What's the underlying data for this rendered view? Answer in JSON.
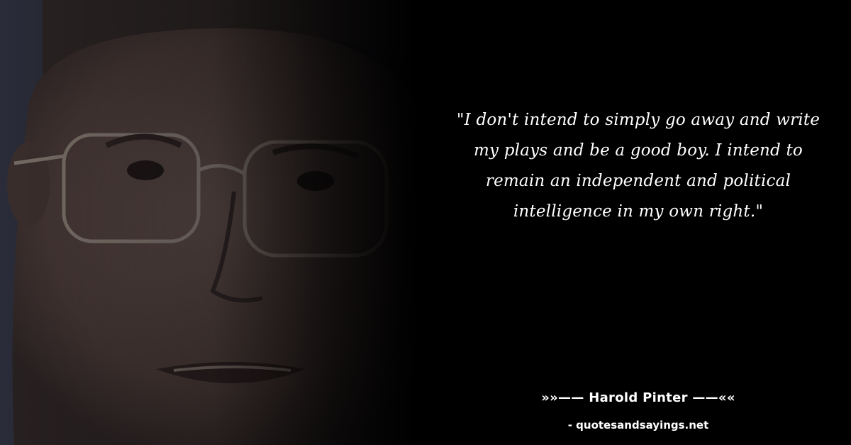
{
  "quote": {
    "text": "\"I don't intend to simply go away and write my plays and be a good boy. I intend to remain an independent and political intelligence in my own right.\""
  },
  "attribution": {
    "author_line": "»»—— Harold Pinter ——««"
  },
  "source": {
    "site_line": "- quotesandsayings.net"
  },
  "colors": {
    "background": "#000000",
    "text": "#ffffff"
  }
}
